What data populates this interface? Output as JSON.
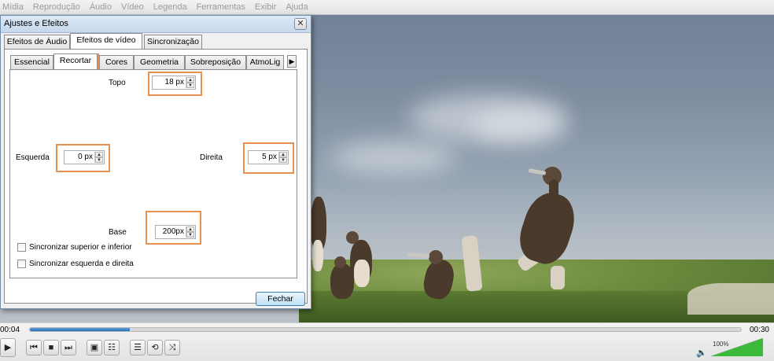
{
  "menu": [
    "Mídia",
    "Reprodução",
    "Áudio",
    "Vídeo",
    "Legenda",
    "Ferramentas",
    "Exibir",
    "Ajuda"
  ],
  "dialog": {
    "title": "Ajustes e Efeitos",
    "close": "✕",
    "main_tabs": [
      "Efeitos de Áudio",
      "Efeitos de vídeo",
      "Sincronização"
    ],
    "sub_tabs": [
      "Essencial",
      "Recortar",
      "Cores",
      "Geometria",
      "Sobreposição",
      "AtmoLig"
    ],
    "sub_tabs_more": "▶",
    "crop": {
      "top_label": "Topo",
      "top_value": "18 px",
      "left_label": "Esquerda",
      "left_value": "0 px",
      "right_label": "Direita",
      "right_value": "5 px",
      "bottom_label": "Base",
      "bottom_value": "200px"
    },
    "checkboxes": [
      "Sincronizar superior e inferior",
      "Sincronizar esquerda e direita"
    ],
    "close_button": "Fechar"
  },
  "player": {
    "elapsed": "00:04",
    "total": "00:30",
    "progress": 0.14,
    "volume": "100%",
    "volume_level": 1.0,
    "icons": [
      "play-icon",
      "previous-icon",
      "stop-icon",
      "next-icon",
      "fullscreen-icon",
      "extended-settings-icon",
      "playlist-icon",
      "loop-icon",
      "shuffle-icon",
      "speaker-icon"
    ]
  },
  "colors": {
    "highlight": "#e8914f",
    "progress": "#2a6fb0",
    "volume": "#3cba3c"
  }
}
